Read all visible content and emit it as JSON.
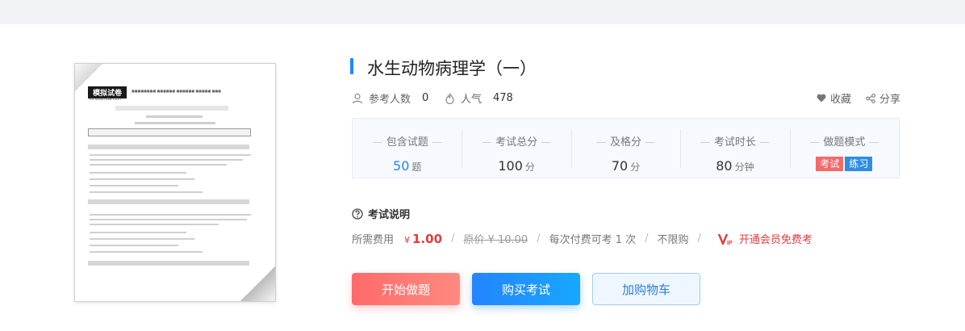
{
  "paper_thumb": {
    "ribbon": "模拟试卷",
    "site": "ks.examda.com"
  },
  "title": "水生动物病理学（一）",
  "meta": {
    "participants_label": "参考人数",
    "participants_value": "0",
    "popularity_label": "人气",
    "popularity_value": "478"
  },
  "actions": {
    "favorite": "收藏",
    "share": "分享"
  },
  "stats": {
    "questions": {
      "label": "包含试题",
      "value": "50",
      "unit": "题"
    },
    "total_score": {
      "label": "考试总分",
      "value": "100",
      "unit": "分"
    },
    "pass_score": {
      "label": "及格分",
      "value": "70",
      "unit": "分"
    },
    "duration": {
      "label": "考试时长",
      "value": "80",
      "unit": "分钟"
    },
    "mode": {
      "label": "做题模式",
      "exam_tag": "考试",
      "practice_tag": "练习"
    }
  },
  "exam_info": {
    "heading": "考试说明",
    "fee_label": "所需费用",
    "currency": "¥",
    "price": "1.00",
    "original_price": "原价 ¥ 10.00",
    "per_pay": "每次付费可考 1 次",
    "limit": "不限购",
    "vip_text": "开通会员免费考"
  },
  "buttons": {
    "start": "开始做题",
    "buy": "购买考试",
    "cart": "加购物车"
  },
  "colors": {
    "accent_blue": "#1e88ff",
    "price_red": "#e33a3a",
    "start_red": "#ff6a6a"
  }
}
